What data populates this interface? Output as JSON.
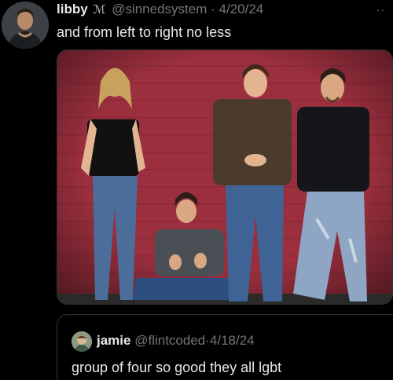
{
  "tweet": {
    "display_name": "libby",
    "name_emoji": "ℳ",
    "handle": "@sinnedsystem",
    "separator": "·",
    "date": "4/20/24",
    "more": "··",
    "text": "and from left to right no less"
  },
  "quote": {
    "display_name": "jamie",
    "handle": "@flintcoded",
    "separator": "·",
    "date": "4/18/24",
    "text": "group of four so good they all lgbt"
  },
  "colors": {
    "background": "#000000",
    "text_primary": "#e7e9ea",
    "text_secondary": "#71767b",
    "border": "#2f3336",
    "brick_wall": "#9b2f3e"
  },
  "media": {
    "kind": "photo",
    "icon": "photo-of-four-people"
  }
}
